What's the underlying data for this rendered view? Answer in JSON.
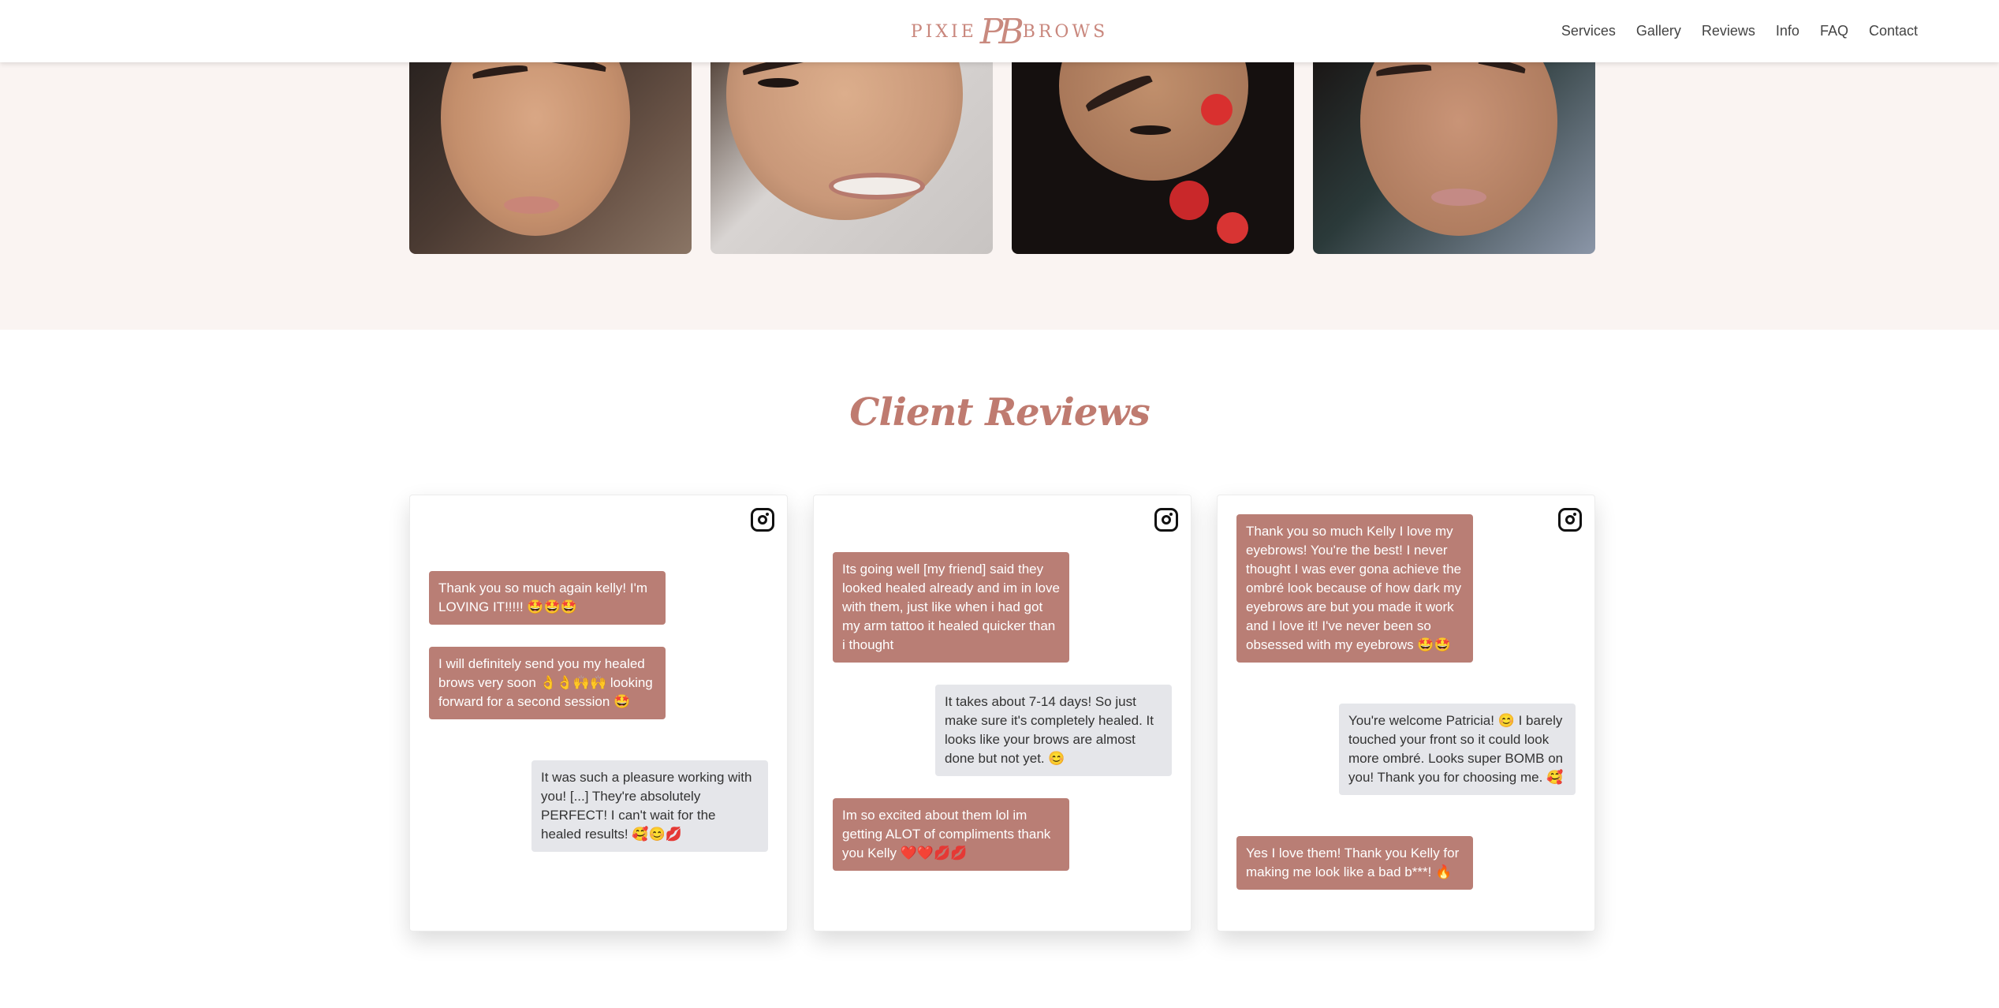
{
  "header": {
    "logo_left": "PIXIE",
    "logo_mono": "PB",
    "logo_right": "BROWS",
    "nav": [
      "Services",
      "Gallery",
      "Reviews",
      "Info",
      "FAQ",
      "Contact"
    ]
  },
  "reviews": {
    "title": "Client Reviews",
    "cards": [
      {
        "messages": [
          {
            "type": "sent",
            "text": "Thank you so much again kelly! I'm LOVING IT!!!!! 🤩🤩🤩"
          },
          {
            "type": "sent",
            "text": "I will definitely send you my healed brows very soon 👌👌🙌🙌 looking forward for a second session 🤩"
          },
          {
            "type": "recv",
            "text": "It was such a pleasure working with you! [...] They're absolutely PERFECT! I can't wait for the healed results! 🥰😊💋"
          }
        ]
      },
      {
        "messages": [
          {
            "type": "sent",
            "text": "Its going well [my friend] said they looked healed already and im in love with them, just like when i had got my arm tattoo it healed quicker than i thought"
          },
          {
            "type": "recv",
            "text": "It takes about 7-14 days! So just make sure it's completely healed. It looks like your brows are almost done but not yet. 😊"
          },
          {
            "type": "sent",
            "text": "Im so excited about them lol im getting ALOT of compliments thank you Kelly ❤️❤️💋💋"
          }
        ]
      },
      {
        "messages": [
          {
            "type": "sent",
            "text": "Thank you so much Kelly I love my eyebrows! You're the best! I never thought I was ever gona achieve the ombré look because of how dark my eyebrows are but you made it work and I love it! I've never been so obsessed with my eyebrows 🤩🤩"
          },
          {
            "type": "recv",
            "text": "You're welcome Patricia! 😊 I barely touched your front so it could look more ombré. Looks super BOMB on you! Thank you for choosing me. 🥰"
          },
          {
            "type": "sent",
            "text": "Yes I love them! Thank you Kelly for making me look like a bad b***! 🔥"
          }
        ]
      }
    ]
  }
}
